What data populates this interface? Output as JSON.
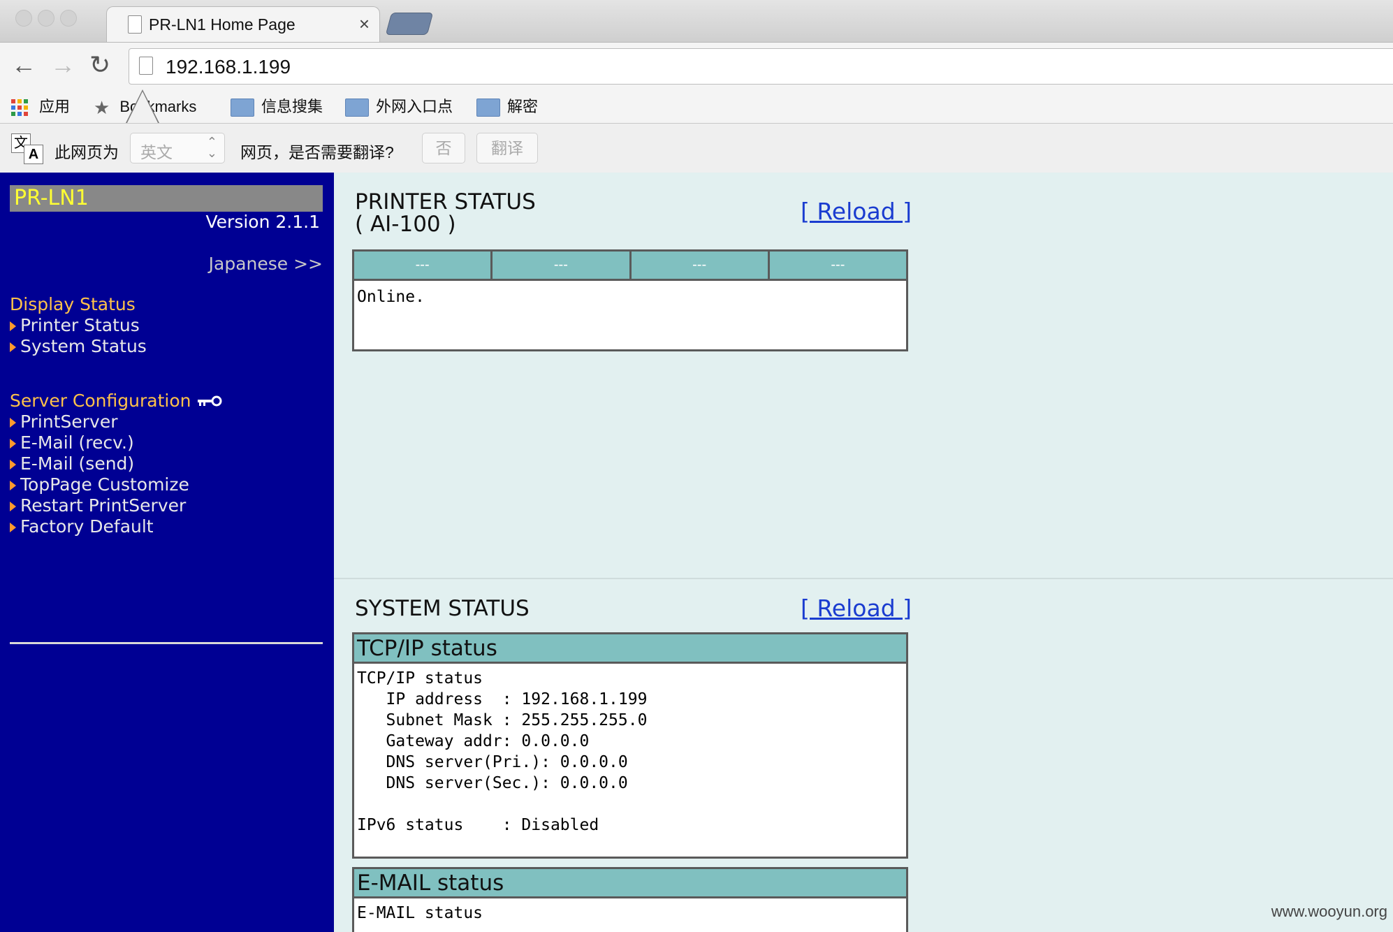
{
  "browser": {
    "tab_title": "PR-LN1 Home Page",
    "tab_close": "×",
    "url": "192.168.1.199",
    "nav": {
      "back": "←",
      "forward": "→",
      "reload": "↻"
    },
    "bookmarks": {
      "apps": "应用",
      "bookmarks": "Bookmarks",
      "folders": [
        "信息搜集",
        "外网入口点",
        "解密"
      ]
    },
    "translate_bar": {
      "prefix": "此网页为",
      "language": "英文",
      "question": "网页，是否需要翻译?",
      "no_button": "否",
      "translate_button": "翻译"
    }
  },
  "sidebar": {
    "brand": "PR-LN1",
    "version": "Version 2.1.1",
    "language_link": "Japanese >>",
    "display_status": {
      "heading": "Display Status",
      "items": [
        "Printer Status",
        "System Status"
      ]
    },
    "server_config": {
      "heading": "Server Configuration",
      "items": [
        "PrintServer",
        "E-Mail (recv.)",
        "E-Mail (send)",
        "TopPage Customize",
        "Restart PrintServer",
        "Factory Default"
      ]
    }
  },
  "printer_status": {
    "title_line1": "PRINTER STATUS",
    "title_line2": "( AI-100 )",
    "reload": "[ Reload ]",
    "cells": [
      "---",
      "---",
      "---",
      "---"
    ],
    "message": "Online."
  },
  "system_status": {
    "title": "SYSTEM STATUS",
    "reload": "[ Reload ]",
    "tcpip_header": "TCP/IP status",
    "tcpip_lines": [
      "TCP/IP status",
      "   IP address  : 192.168.1.199",
      "   Subnet Mask : 255.255.255.0",
      "   Gateway addr: 0.0.0.0",
      "   DNS server(Pri.): 0.0.0.0",
      "   DNS server(Sec.): 0.0.0.0",
      "",
      "IPv6 status    : Disabled"
    ],
    "email_header": "E-MAIL status",
    "email_lines": [
      "E-MAIL status"
    ]
  },
  "watermark": "www.wooyun.org",
  "colors": {
    "sidebar_bg": "#000093",
    "main_bg": "#e2f0f0",
    "table_header": "#80c0c0",
    "section_heading": "#ffc24a",
    "link": "#1a3cd0"
  }
}
